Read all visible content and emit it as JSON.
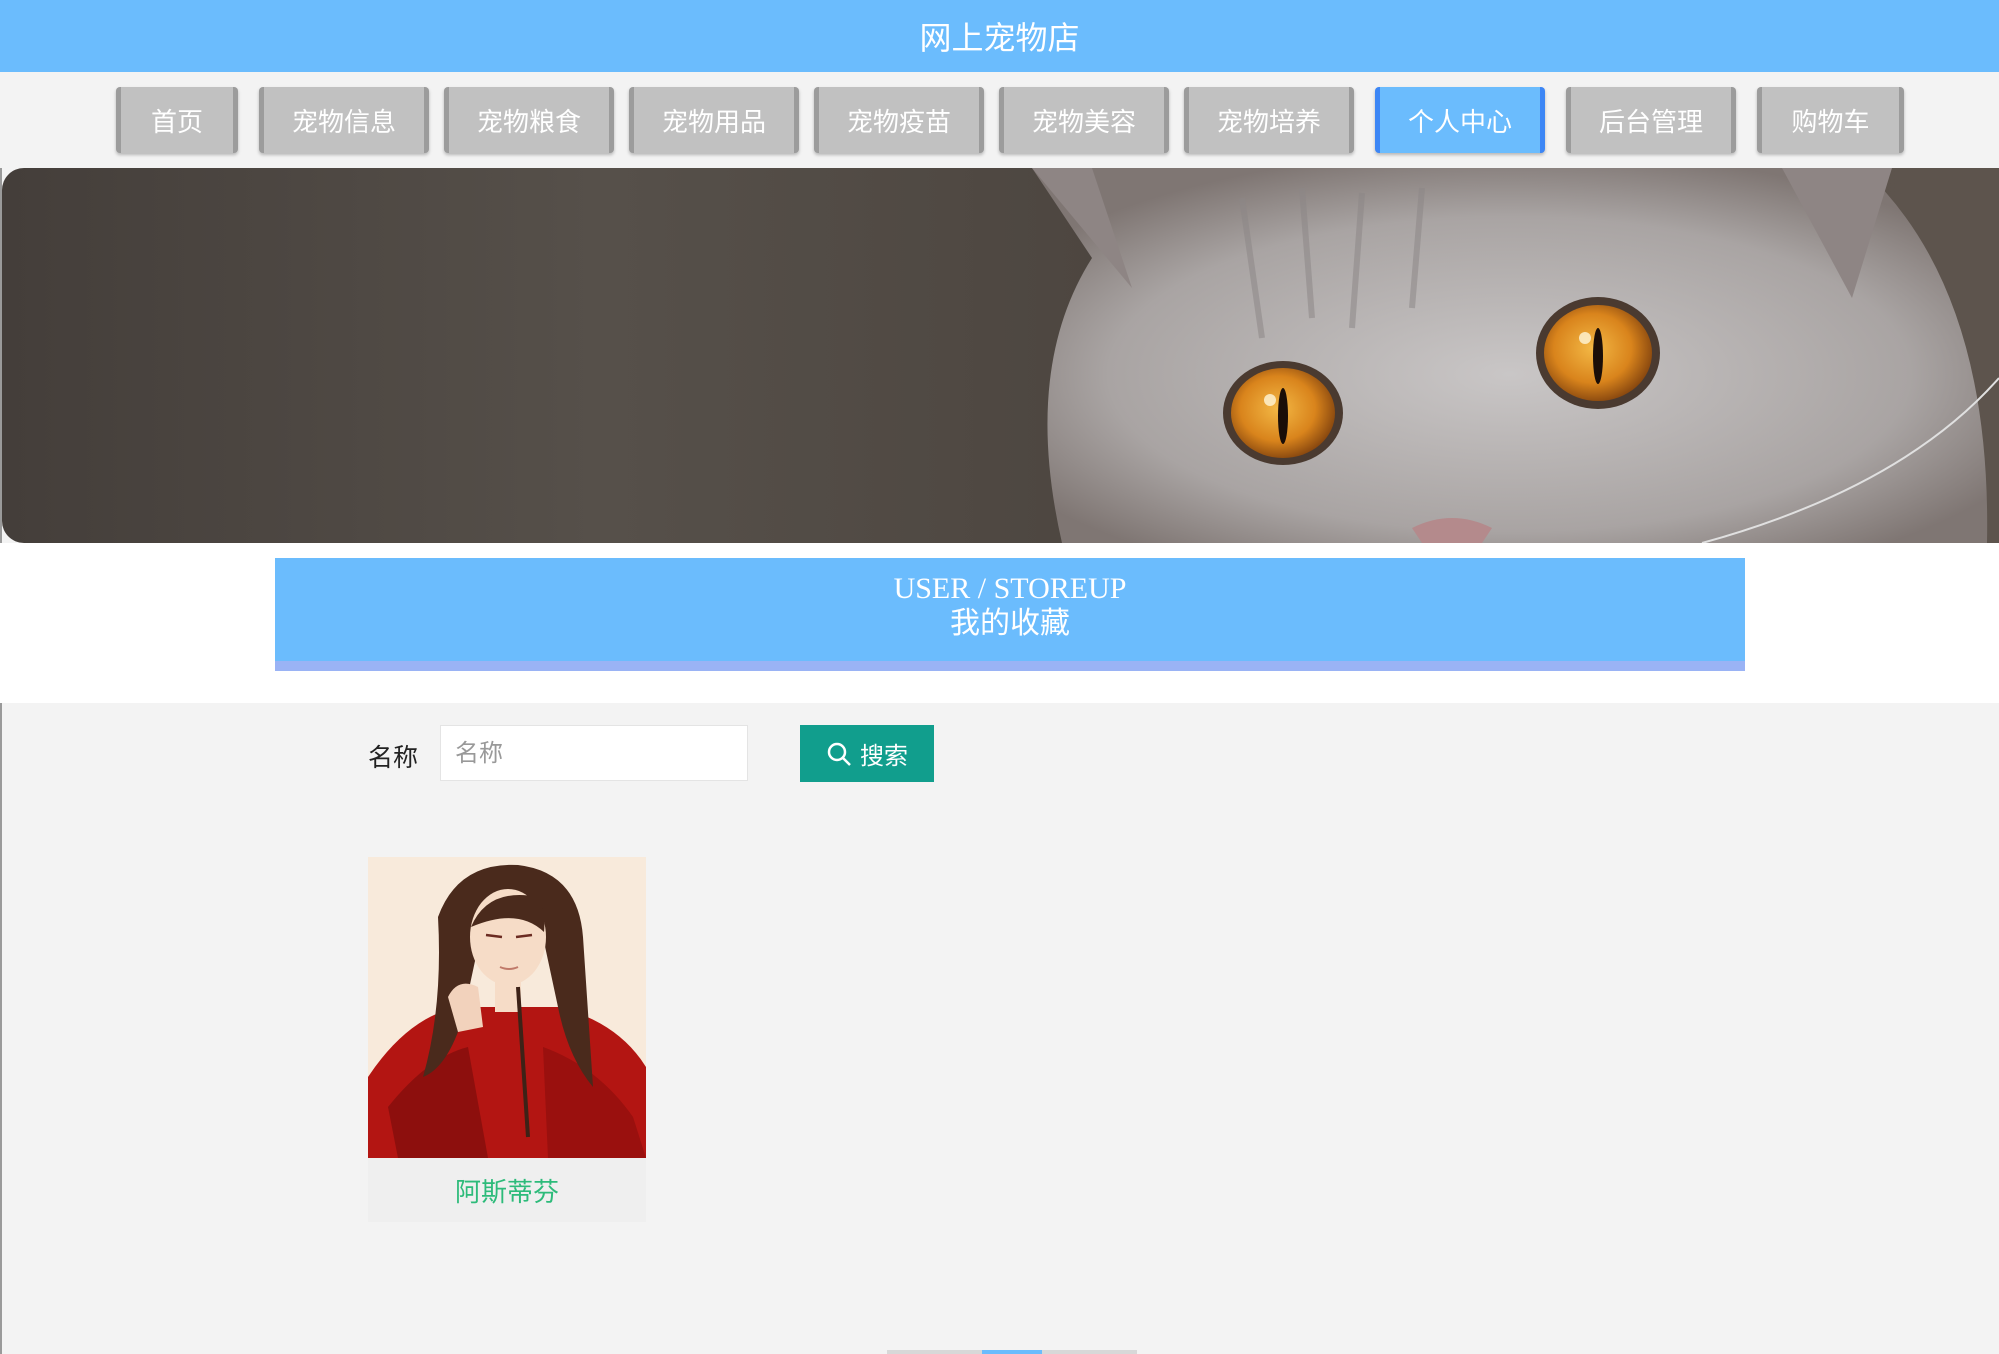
{
  "header": {
    "title": "网上宠物店"
  },
  "nav": {
    "items": [
      {
        "label": "首页",
        "active": false
      },
      {
        "label": "宠物信息",
        "active": false
      },
      {
        "label": "宠物粮食",
        "active": false
      },
      {
        "label": "宠物用品",
        "active": false
      },
      {
        "label": "宠物疫苗",
        "active": false
      },
      {
        "label": "宠物美容",
        "active": false
      },
      {
        "label": "宠物培养",
        "active": false
      },
      {
        "label": "个人中心",
        "active": true
      },
      {
        "label": "后台管理",
        "active": false
      },
      {
        "label": "购物车",
        "active": false
      }
    ]
  },
  "section": {
    "title_en": "USER / STOREUP",
    "title_cn": "我的收藏"
  },
  "search": {
    "label": "名称",
    "placeholder": "名称",
    "value": "",
    "button_label": "搜索"
  },
  "favorites": [
    {
      "name": "阿斯蒂芬"
    }
  ],
  "colors": {
    "primary": "#6bbcfd",
    "active_border": "#3c86f5",
    "search_button": "#119e8d",
    "item_name": "#2dbb7a"
  }
}
